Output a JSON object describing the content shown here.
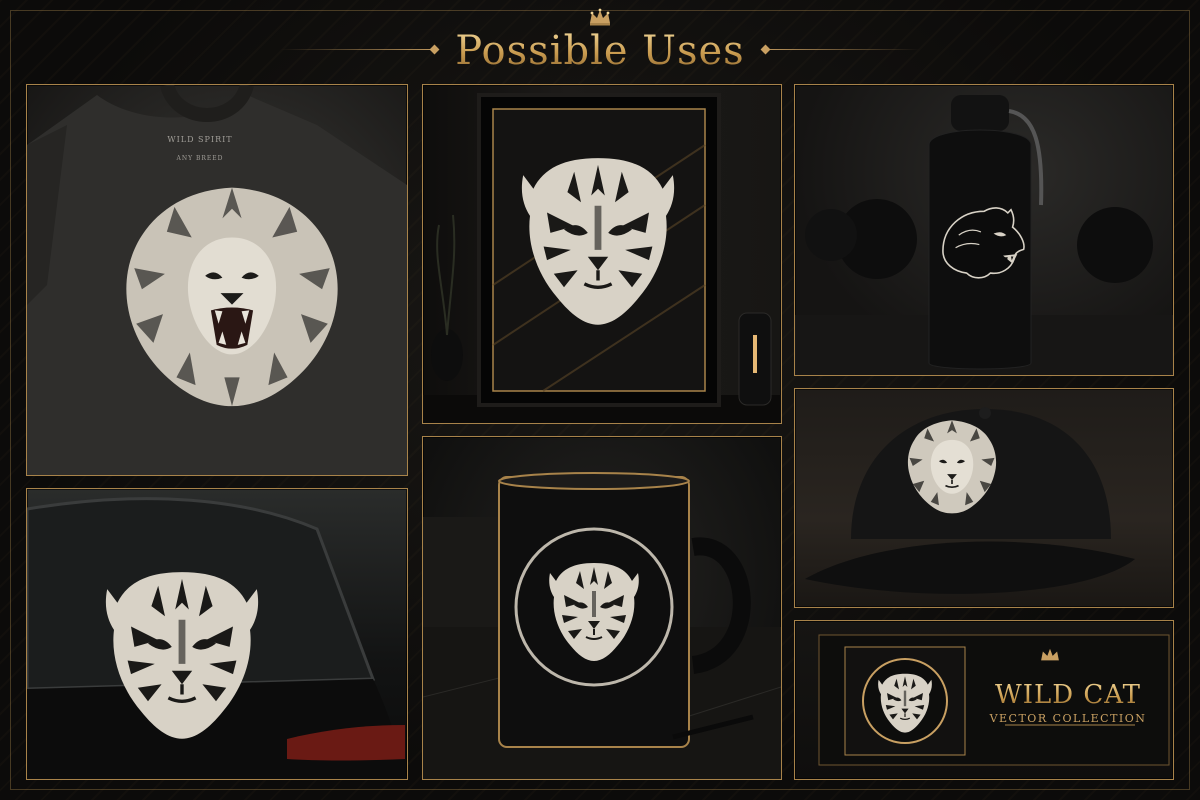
{
  "header": {
    "title": "Possible Uses"
  },
  "panels": {
    "tshirt": {
      "brand_line_1": "WILD SPIRIT",
      "brand_line_2": "ANY BREED",
      "artwork": "lion-roaring-icon"
    },
    "framed_print": {
      "artwork": "tiger-head-icon"
    },
    "water_bottle": {
      "artwork": "panther-head-icon"
    },
    "car_decal": {
      "artwork": "tiger-head-icon"
    },
    "mug": {
      "artwork": "tiger-head-icon"
    },
    "cap": {
      "artwork": "lion-head-icon"
    },
    "box": {
      "title": "WILD CAT",
      "subtitle": "VECTOR COLLECTION",
      "artwork": "tiger-head-icon"
    }
  },
  "colors": {
    "gold": "#c9a062",
    "gold_light": "#f1d596",
    "background": "#0c0b0a",
    "print_ink": "#d8d2c6"
  }
}
